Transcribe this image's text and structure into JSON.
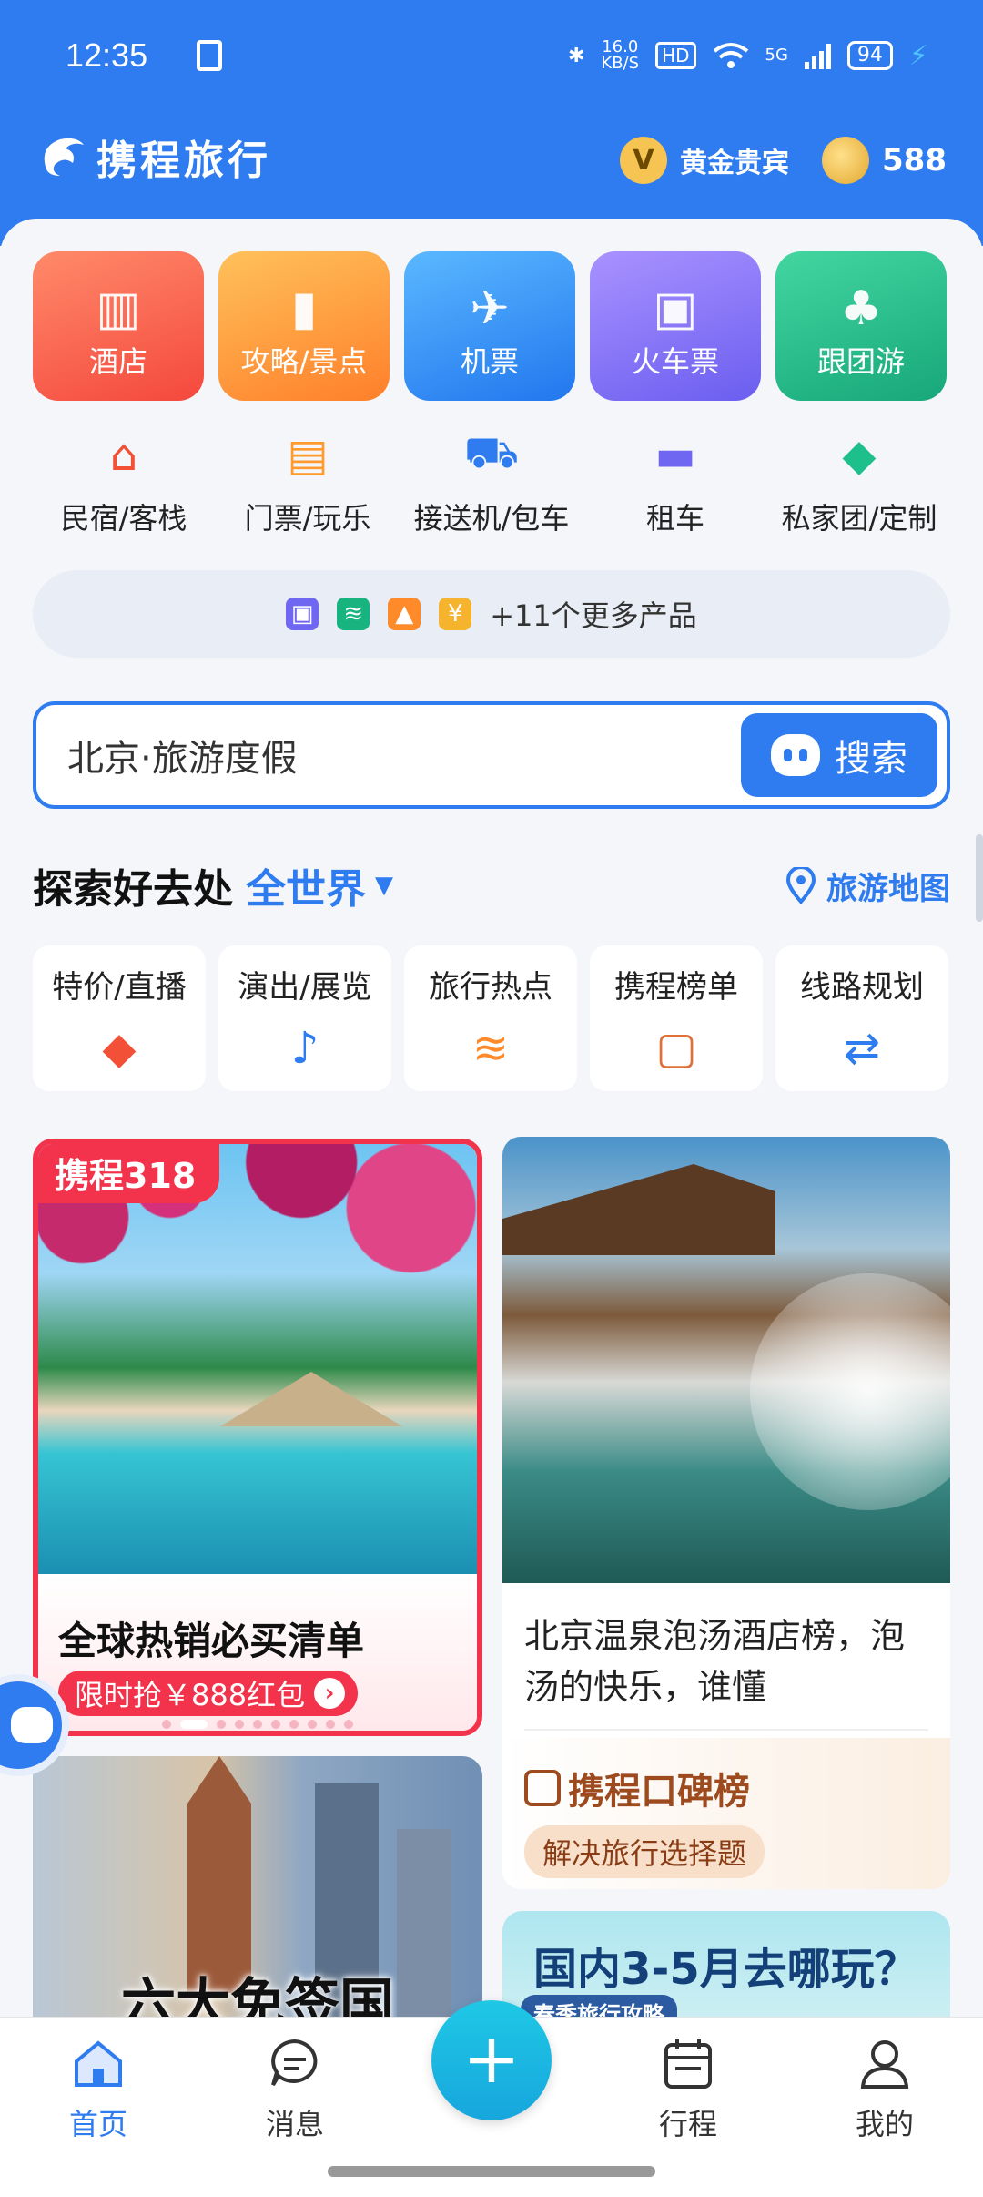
{
  "status_bar": {
    "time": "12:35",
    "net_speed": "16.0",
    "net_unit": "KB/S",
    "hd": "HD",
    "net_type": "5G",
    "battery": "94"
  },
  "header": {
    "logo_text": "携程旅行",
    "member_badge": "V",
    "member_level": "黄金贵宾",
    "points": "588"
  },
  "main_tiles": [
    {
      "label": "酒店",
      "icon": "hotel-icon"
    },
    {
      "label": "攻略/景点",
      "icon": "guide-book-icon"
    },
    {
      "label": "机票",
      "icon": "airplane-icon"
    },
    {
      "label": "火车票",
      "icon": "train-icon"
    },
    {
      "label": "跟团游",
      "icon": "palm-tree-icon"
    }
  ],
  "sub_items": [
    {
      "label": "民宿/客栈",
      "icon": "homestay-icon"
    },
    {
      "label": "门票/玩乐",
      "icon": "ticket-icon"
    },
    {
      "label": "接送机/包车",
      "icon": "taxi-icon"
    },
    {
      "label": "租车",
      "icon": "car-icon"
    },
    {
      "label": "私家团/定制",
      "icon": "private-tour-icon"
    }
  ],
  "more_products": {
    "label": "+11个更多产品"
  },
  "search": {
    "query": "北京·旅游度假",
    "button": "搜索"
  },
  "explore": {
    "title": "探索好去处",
    "region": "全世界",
    "map_link": "旅游地图"
  },
  "categories": [
    {
      "label": "特价/直播",
      "icon": "price-tag-icon"
    },
    {
      "label": "演出/展览",
      "icon": "music-note-icon"
    },
    {
      "label": "旅行热点",
      "icon": "flag-icon"
    },
    {
      "label": "携程榜单",
      "icon": "ranking-icon"
    },
    {
      "label": "线路规划",
      "icon": "route-icon"
    }
  ],
  "feed": {
    "card1": {
      "tag": "携程318",
      "headline": "全球热销必买清单",
      "deal": "限时抢￥888红包"
    },
    "card2": {
      "title": "北京温泉泡汤酒店榜，泡汤的快乐，谁懂",
      "rank_logo": "携程口碑榜",
      "chip": "解决旅行选择题"
    },
    "card3": {
      "caption": "六大免签国"
    },
    "card4": {
      "title": "国内3-5月去哪玩？",
      "subtitle": "春季旅行攻略"
    }
  },
  "tabbar": {
    "home": "首页",
    "messages": "消息",
    "trips": "行程",
    "me": "我的",
    "plus": "+"
  },
  "colors": {
    "primary": "#2f7cf0",
    "accent_red": "#f2334b"
  }
}
